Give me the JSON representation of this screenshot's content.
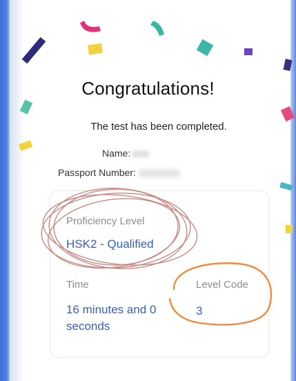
{
  "result": {
    "title": "Congratulations!",
    "subtitle": "The test has been completed.",
    "name_label": "Name:",
    "passport_label": "Passport Number:"
  },
  "card": {
    "proficiency_label": "Proficiency Level",
    "proficiency_value": "HSK2 - Qualified",
    "time_label": "Time",
    "time_value_line1": "16 minutes and 0",
    "time_value_line2": "seconds",
    "level_code_label": "Level Code",
    "level_code_value": "3"
  },
  "colors": {
    "accent_blue": "#3560b8",
    "annotation_red": "#c98a84",
    "annotation_orange": "#f08a3a"
  }
}
